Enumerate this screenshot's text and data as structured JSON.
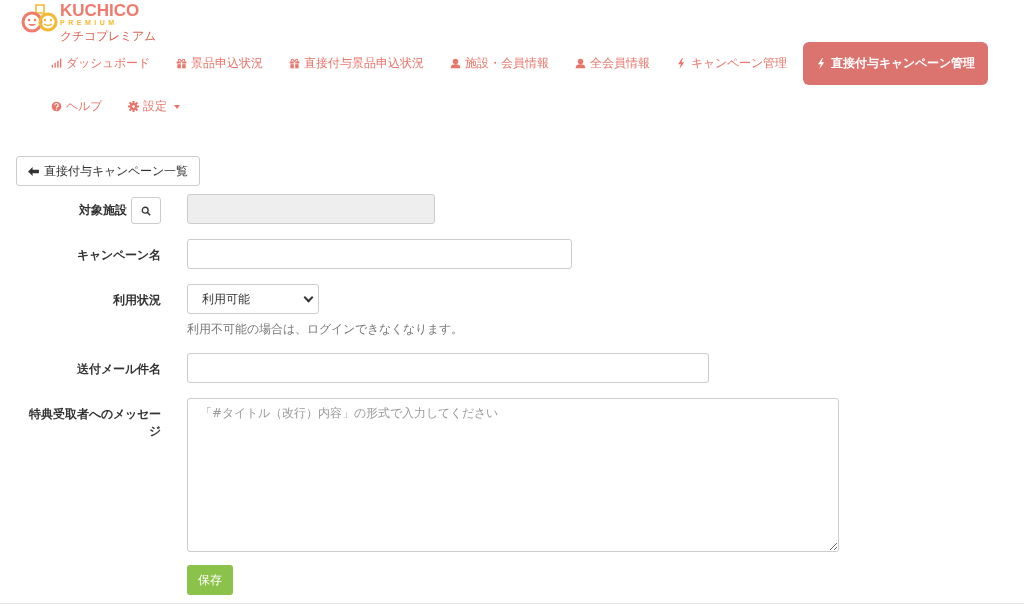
{
  "logo": {
    "name": "KUCHICO",
    "sub": "PREMIUM",
    "kana": "クチコプレミアム"
  },
  "nav": [
    {
      "label": "ダッシュボード",
      "kind": "bars",
      "selected": false
    },
    {
      "label": "景品申込状況",
      "kind": "gift",
      "selected": false
    },
    {
      "label": "直接付与景品申込状況",
      "kind": "gift",
      "selected": false
    },
    {
      "label": "施設・会員情報",
      "kind": "user",
      "selected": false
    },
    {
      "label": "全会員情報",
      "kind": "user",
      "selected": false
    },
    {
      "label": "キャンペーン管理",
      "kind": "bolt",
      "selected": false
    },
    {
      "label": "直接付与キャンペーン管理",
      "kind": "bolt",
      "selected": true
    },
    {
      "label": "ヘルプ",
      "kind": "help",
      "selected": false
    },
    {
      "label": "設定",
      "kind": "gear",
      "selected": false,
      "dropdown": true
    }
  ],
  "back_button": {
    "label": "直接付与キャンペーン一覧"
  },
  "form": [
    {
      "label": "対象施設",
      "kind": "lookup",
      "disabled": true
    },
    {
      "label": "キャンペーン名",
      "kind": "text",
      "disabled": false
    },
    {
      "label": "利用状況",
      "kind": "select",
      "value": "利用可能",
      "hint": "利用不可能の場合は、ログインできなくなります。"
    },
    {
      "label": "送付メール件名",
      "kind": "text",
      "disabled": false
    },
    {
      "label": "特典受取者へのメッセージ",
      "kind": "textarea",
      "placeholder": "「#タイトル（改行）内容」の形式で入力してください"
    }
  ],
  "save_button": {
    "label": "保存"
  }
}
